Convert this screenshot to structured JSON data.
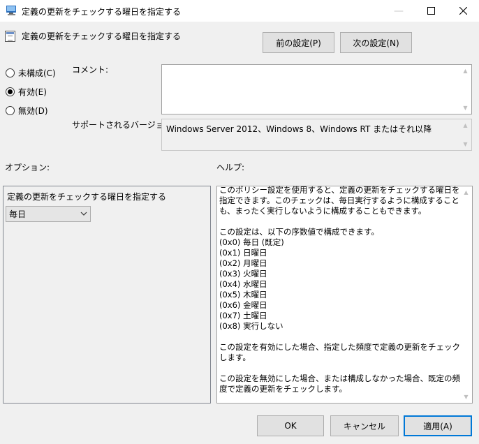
{
  "window": {
    "title": "定義の更新をチェックする曜日を指定する"
  },
  "header": {
    "policy_title": "定義の更新をチェックする曜日を指定する",
    "prev_button": "前の設定(P)",
    "next_button": "次の設定(N)"
  },
  "state": {
    "options": [
      {
        "label": "未構成(C)",
        "selected": false
      },
      {
        "label": "有効(E)",
        "selected": true
      },
      {
        "label": "無効(D)",
        "selected": false
      }
    ]
  },
  "comment": {
    "label": "コメント:",
    "value": ""
  },
  "supported": {
    "label": "サポートされるバージョン:",
    "value": "Windows Server 2012、Windows 8、Windows RT またはそれ以降"
  },
  "options_panel": {
    "label": "オプション:",
    "field_label": "定義の更新をチェックする曜日を指定する",
    "selected": "毎日"
  },
  "help_panel": {
    "label": "ヘルプ:",
    "lines": [
      "このポリシー設定を使用すると、定義の更新をチェックする曜日を指定できます。このチェックは、毎日実行するように構成することも、まったく実行しないように構成することもできます。",
      "",
      "この設定は、以下の序数値で構成できます。",
      "(0x0) 毎日 (既定)",
      "(0x1) 日曜日",
      "(0x2) 月曜日",
      "(0x3) 火曜日",
      "(0x4) 水曜日",
      "(0x5) 木曜日",
      "(0x6) 金曜日",
      "(0x7) 土曜日",
      "(0x8) 実行しない",
      "",
      "この設定を有効にした場合、指定した頻度で定義の更新をチェックします。",
      "",
      "この設定を無効にした場合、または構成しなかった場合、既定の頻度で定義の更新をチェックします。"
    ]
  },
  "footer": {
    "ok": "OK",
    "cancel": "キャンセル",
    "apply": "適用(A)"
  }
}
